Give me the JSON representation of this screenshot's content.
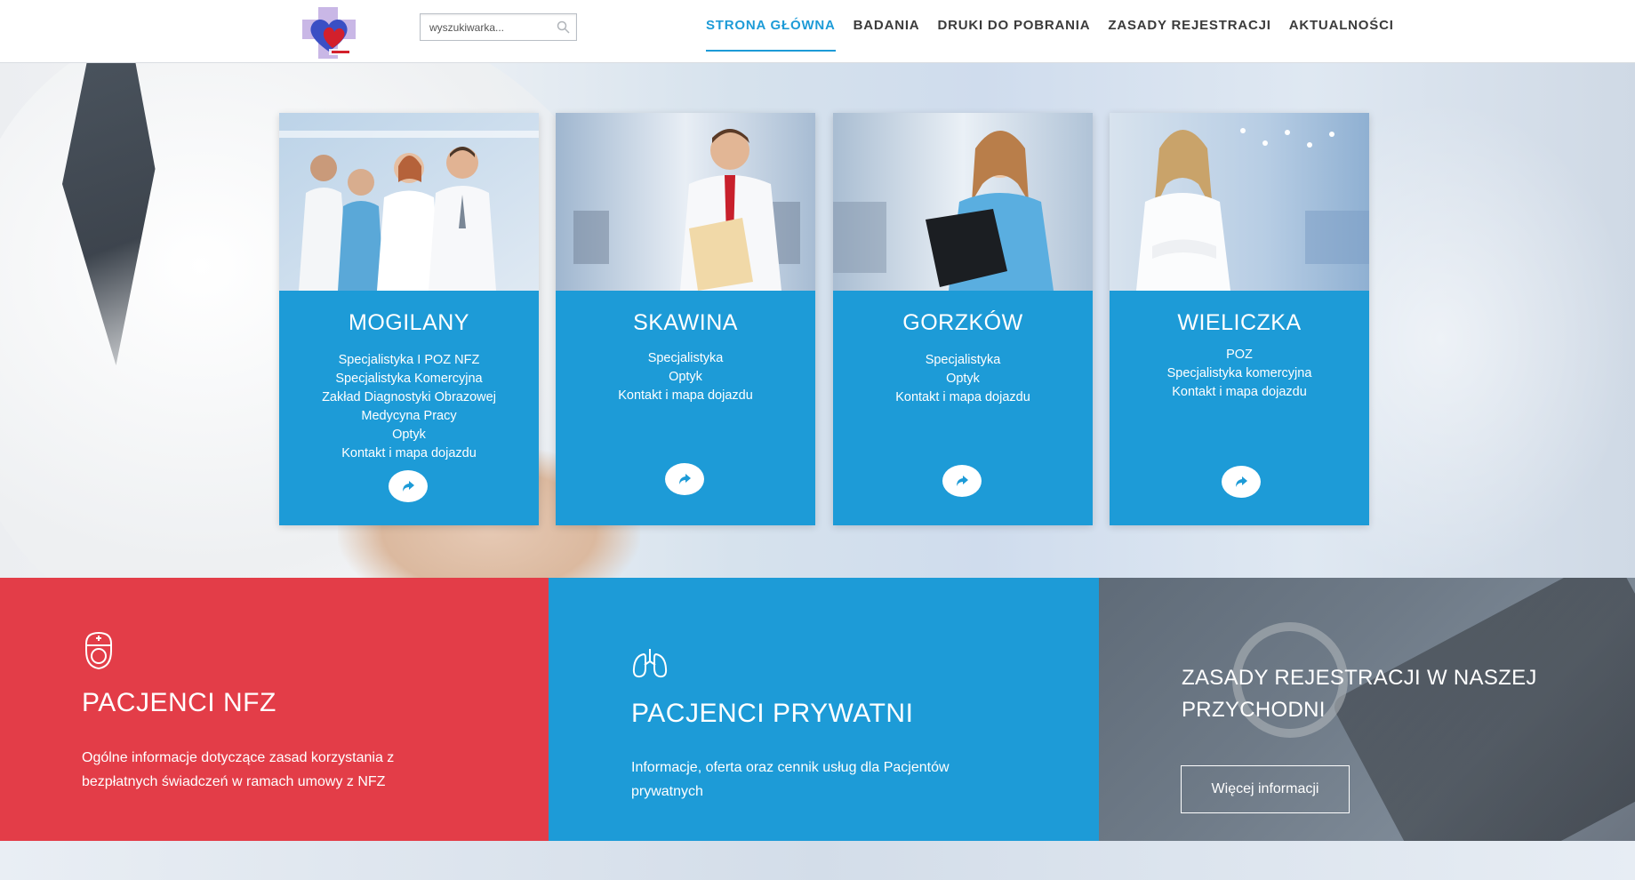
{
  "header": {
    "logo_icon": "heart-cross-logo",
    "search": {
      "placeholder": "wyszukiwarka...",
      "value": ""
    },
    "nav": [
      {
        "label": "STRONA GŁÓWNA",
        "active": true
      },
      {
        "label": "BADANIA",
        "active": false
      },
      {
        "label": "DRUKI DO POBRANIA",
        "active": false
      },
      {
        "label": "ZASADY REJESTRACJI",
        "active": false
      },
      {
        "label": "AKTUALNOŚCI",
        "active": false
      }
    ]
  },
  "cards": [
    {
      "title": "MOGILANY",
      "links": [
        "Specjalistyka I POZ NFZ",
        "Specjalistyka Komercyjna",
        "Zakład Diagnostyki Obrazowej",
        "Medycyna Pracy",
        "Optyk",
        "Kontakt i mapa dojazdu"
      ],
      "button_icon": "share-arrow-icon"
    },
    {
      "title": "SKAWINA",
      "links": [
        "Specjalistyka",
        "Optyk",
        "Kontakt i mapa dojazdu"
      ],
      "button_icon": "share-arrow-icon"
    },
    {
      "title": "GORZKÓW",
      "links": [
        "Specjalistyka",
        "Optyk",
        "Kontakt i mapa dojazdu"
      ],
      "button_icon": "share-arrow-icon"
    },
    {
      "title": "WIELICZKA",
      "links": [
        "POZ",
        "Specjalistyka komercyjna",
        "Kontakt i mapa dojazdu"
      ],
      "button_icon": "share-arrow-icon"
    }
  ],
  "panels": {
    "nfz": {
      "icon": "nurse-icon",
      "title": "PACJENCI NFZ",
      "text_line1": "Ogólne informacje dotyczące zasad korzystania z",
      "text_line2": "bezpłatnych świadczeń w ramach umowy z NFZ"
    },
    "private": {
      "icon": "lungs-icon",
      "title": "PACJENCI PRYWATNI",
      "text_line1": "Informacje, oferta oraz cennik usług dla Pacjentów",
      "text_line2": "prywatnych"
    },
    "registration": {
      "title": "ZASADY REJESTRACJI W NASZEJ PRZYCHODNI",
      "button": "Więcej informacji"
    }
  },
  "colors": {
    "accent_blue": "#1d9bd7",
    "accent_red": "#e33d48",
    "nav_text": "#3b3b3b"
  }
}
